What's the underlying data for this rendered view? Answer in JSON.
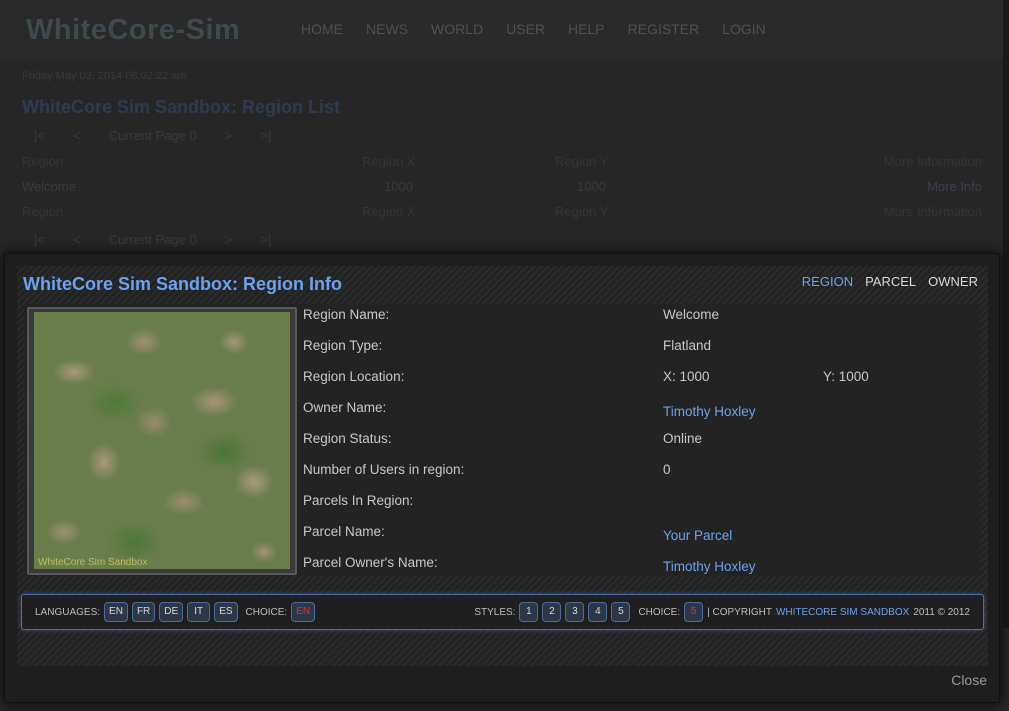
{
  "site": {
    "logo": "WhiteCore-Sim"
  },
  "topnav": [
    "HOME",
    "NEWS",
    "WORLD",
    "USER",
    "HELP",
    "REGISTER",
    "LOGIN"
  ],
  "background": {
    "date": "Friday May 02, 2014 08:02:22 am",
    "title": "WhiteCore Sim Sandbox: Region List",
    "pager": [
      "|<",
      "<",
      "Current Page 0",
      ">",
      ">|"
    ],
    "table_header": [
      "Region",
      "Region X",
      "Region Y",
      "More Information"
    ],
    "rows": [
      {
        "region": "Welcome",
        "x": "1000",
        "y": "1000",
        "more": "More Info"
      }
    ]
  },
  "modal": {
    "title": "WhiteCore Sim Sandbox: Region Info",
    "tabs": [
      "REGION",
      "PARCEL",
      "OWNER"
    ],
    "active_tab": "REGION",
    "map_caption": "WhiteCore Sim Sandbox",
    "info": {
      "region_name_label": "Region Name:",
      "region_name": "Welcome",
      "region_type_label": "Region Type:",
      "region_type": "Flatland",
      "region_location_label": "Region Location:",
      "region_x": "X: 1000",
      "region_y": "Y: 1000",
      "owner_name_label": "Owner Name:",
      "owner_name": "Timothy Hoxley",
      "region_status_label": "Region Status:",
      "region_status": "Online",
      "users_label": "Number of Users in region:",
      "users": "0",
      "parcels_label": "Parcels In Region:",
      "parcel_name_label": "Parcel Name:",
      "parcel_name": "Your Parcel",
      "parcel_owner_label": "Parcel Owner's Name:",
      "parcel_owner": "Timothy Hoxley"
    },
    "footer": {
      "languages_label": "LANGUAGES:",
      "languages": [
        "EN",
        "FR",
        "DE",
        "IT",
        "ES"
      ],
      "choice_label": "CHOICE:",
      "language_choice": "EN",
      "styles_label": "STYLES:",
      "styles": [
        "1",
        "2",
        "3",
        "4",
        "5"
      ],
      "style_choice": "5",
      "copyright_prefix": "| COPYRIGHT",
      "copyright_link": "WHITECORE SIM SANDBOX",
      "copyright_suffix": "2011 © 2012"
    },
    "close_label": "Close"
  }
}
